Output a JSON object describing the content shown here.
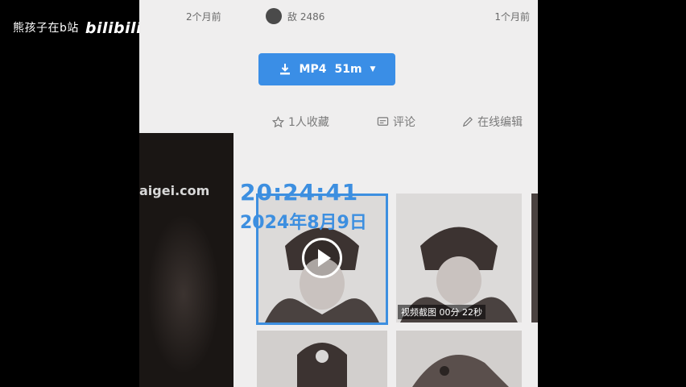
{
  "overlay": {
    "watermark_text": "熊孩子在b站",
    "watermark_logo": "bilibili",
    "time": "20:24:41",
    "date": "2024年8月9日"
  },
  "header": {
    "time_left": "2个月前",
    "user": "敌 2486",
    "time_right": "1个月前"
  },
  "download": {
    "format": "MP4",
    "size": "51m"
  },
  "actions": {
    "favorites": "1人收藏",
    "comments": "评论",
    "edit": "在线编辑"
  },
  "video_panel": {
    "site": "aigei.com"
  },
  "thumbnails": [
    {
      "caption": ""
    },
    {
      "caption": "视频截图 00分 22秒"
    }
  ],
  "colors": {
    "accent": "#3a8ee6",
    "page_bg": "#efeeee",
    "stamp": "#3d8fe0"
  }
}
